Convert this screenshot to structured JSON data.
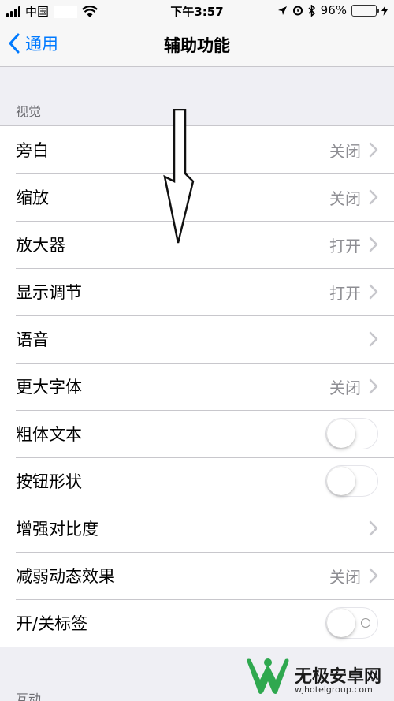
{
  "status_bar": {
    "carrier": "中国",
    "time": "下午3:57",
    "battery_percent": "96%",
    "battery_level": 0.96
  },
  "nav": {
    "back_label": "通用",
    "title": "辅助功能"
  },
  "sections": {
    "vision_header": "视觉",
    "interaction_header": "互动"
  },
  "rows": [
    {
      "label": "旁白",
      "value": "关闭",
      "type": "disclosure"
    },
    {
      "label": "缩放",
      "value": "关闭",
      "type": "disclosure"
    },
    {
      "label": "放大器",
      "value": "打开",
      "type": "disclosure"
    },
    {
      "label": "显示调节",
      "value": "打开",
      "type": "disclosure"
    },
    {
      "label": "语音",
      "value": "",
      "type": "disclosure"
    },
    {
      "label": "更大字体",
      "value": "关闭",
      "type": "disclosure"
    },
    {
      "label": "粗体文本",
      "type": "toggle",
      "on": false
    },
    {
      "label": "按钮形状",
      "type": "toggle",
      "on": false
    },
    {
      "label": "增强对比度",
      "value": "",
      "type": "disclosure"
    },
    {
      "label": "减弱动态效果",
      "value": "关闭",
      "type": "disclosure"
    },
    {
      "label": "开/关标签",
      "type": "toggle",
      "on": false
    }
  ],
  "watermark": {
    "name": "无极安卓网",
    "url": "wjhotelgroup.com"
  },
  "colors": {
    "accent": "#007aff",
    "background": "#efeff4",
    "separator": "#c8c7cc",
    "secondary_text": "#8e8e93",
    "battery": "#4cd964"
  },
  "icons": [
    "signal-icon",
    "wifi-icon",
    "location-icon",
    "alarm-icon",
    "bluetooth-icon",
    "battery-icon",
    "charging-icon",
    "back-chevron-icon",
    "chevron-right-icon",
    "down-arrow-annotation"
  ]
}
